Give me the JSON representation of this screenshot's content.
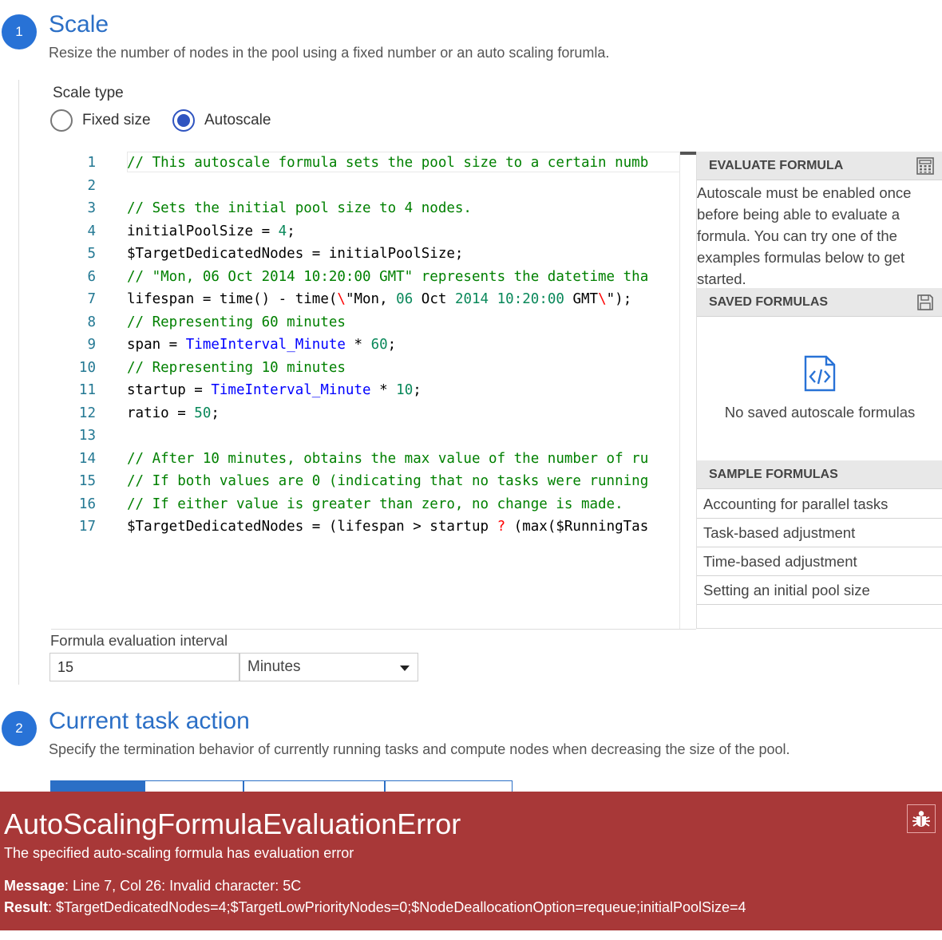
{
  "step1": {
    "number": "1",
    "title": "Scale",
    "description": "Resize the number of nodes in the pool using a fixed number or an auto scaling forumla.",
    "scale_type_label": "Scale type",
    "options": [
      "Fixed size",
      "Autoscale"
    ],
    "selected": "Autoscale"
  },
  "code": {
    "lines": [
      {
        "n": "1"
      },
      {
        "n": "2"
      },
      {
        "n": "3"
      },
      {
        "n": "4"
      },
      {
        "n": "5"
      },
      {
        "n": "6"
      },
      {
        "n": "7"
      },
      {
        "n": "8"
      },
      {
        "n": "9"
      },
      {
        "n": "10"
      },
      {
        "n": "11"
      },
      {
        "n": "12"
      },
      {
        "n": "13"
      },
      {
        "n": "14"
      },
      {
        "n": "15"
      },
      {
        "n": "16"
      },
      {
        "n": "17"
      }
    ],
    "l1": "// This autoscale formula sets the pool size to a certain numb",
    "l3": "// Sets the initial pool size to 4 nodes.",
    "l4a": "initialPoolSize = ",
    "l4b": "4",
    "l4c": ";",
    "l5": "$TargetDedicatedNodes = initialPoolSize;",
    "l6": "// \"Mon, 06 Oct 2014 10:20:00 GMT\" represents the datetime tha",
    "l7a": "lifespan = time() - time(",
    "l7b": "\\",
    "l7c": "\"Mon, ",
    "l7d": "06",
    "l7e": " Oct ",
    "l7f": "2014",
    "l7g": " ",
    "l7h": "10:20:00",
    "l7i": " GMT",
    "l7j": "\\",
    "l7k": "\");",
    "l8": "// Representing 60 minutes",
    "l9a": "span = ",
    "l9b": "TimeInterval_Minute",
    "l9c": " * ",
    "l9d": "60",
    "l9e": ";",
    "l10": "// Representing 10 minutes",
    "l11a": "startup = ",
    "l11b": "TimeInterval_Minute",
    "l11c": " * ",
    "l11d": "10",
    "l11e": ";",
    "l12a": "ratio = ",
    "l12b": "50",
    "l12c": ";",
    "l14": "// After 10 minutes, obtains the max value of the number of ru",
    "l15": "// If both values are 0 (indicating that no tasks were running",
    "l16": "// If either value is greater than zero, no change is made.",
    "l17a": "$TargetDedicatedNodes = (lifespan > startup ",
    "l17b": "?",
    "l17c": " (max($RunningTas"
  },
  "panel": {
    "evaluate_header": "EVALUATE FORMULA",
    "evaluate_text": "Autoscale must be enabled once before being able to evaluate a formula. You can try one of the examples formulas below to get started.",
    "saved_header": "SAVED FORMULAS",
    "saved_empty": "No saved autoscale formulas",
    "sample_header": "SAMPLE FORMULAS",
    "samples": [
      "Accounting for parallel tasks",
      "Task-based adjustment",
      "Time-based adjustment",
      "Setting an initial pool size"
    ]
  },
  "interval": {
    "label": "Formula evaluation interval",
    "value": "15",
    "unit": "Minutes"
  },
  "step2": {
    "number": "2",
    "title": "Current task action",
    "description": "Specify the termination behavior of currently running tasks and compute nodes when decreasing the size of the pool."
  },
  "error": {
    "title": "AutoScalingFormulaEvaluationError",
    "subtitle": "The specified auto-scaling formula has evaluation error",
    "message_label": "Message",
    "message_value": ": Line 7, Col 26: Invalid character: 5C",
    "result_label": "Result",
    "result_value": ": $TargetDedicatedNodes=4;$TargetLowPriorityNodes=0;$NodeDeallocationOption=requeue;initialPoolSize=4",
    "bug_icon": "bug-icon",
    "color": "#a83838"
  }
}
